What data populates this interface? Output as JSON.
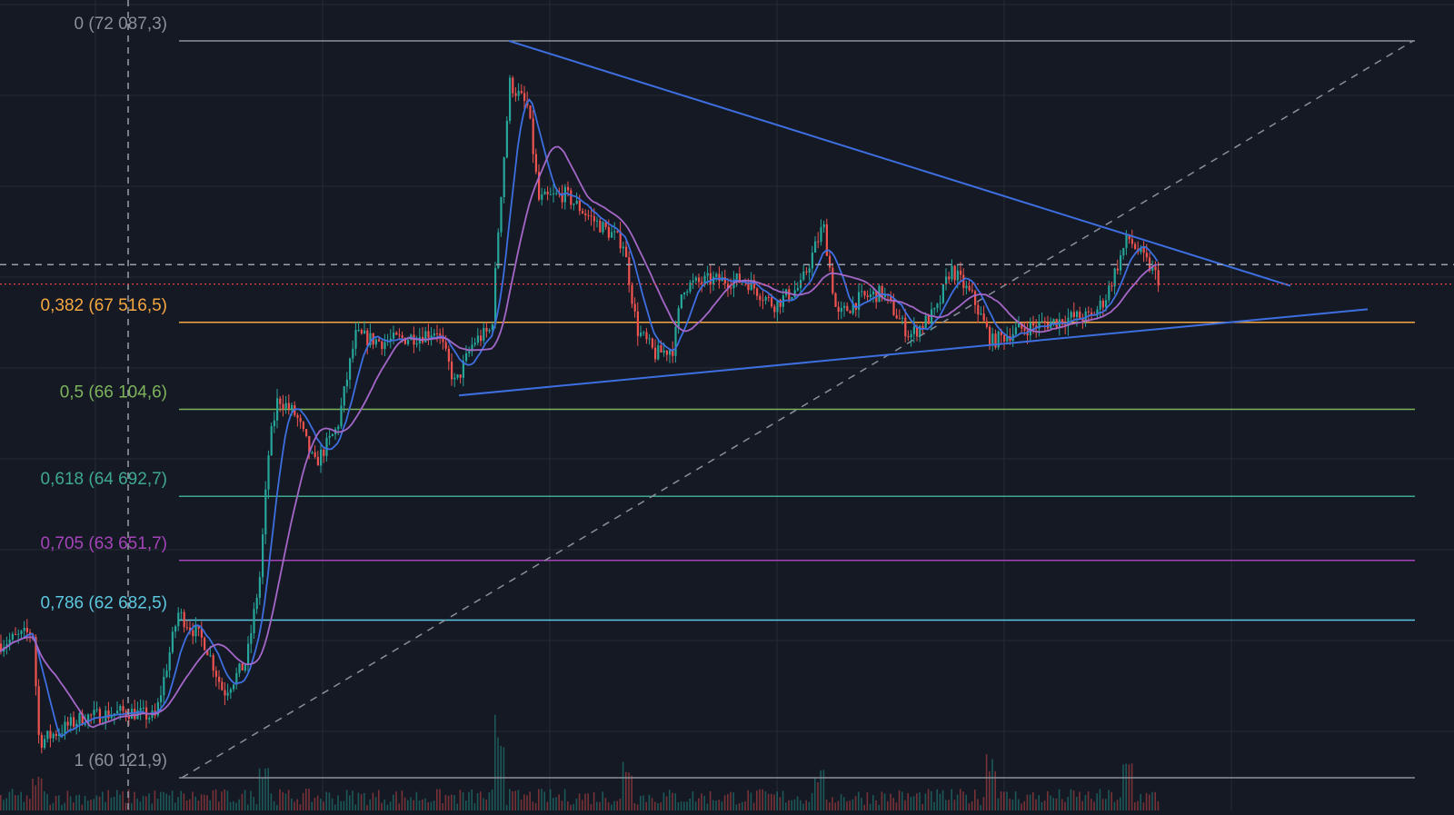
{
  "colors": {
    "background": "#151924",
    "grid": "#252a36",
    "candle_up": "#26a69a",
    "candle_down": "#ef5350",
    "ma_fast": "#3d6fe0",
    "ma_slow": "#a467c8",
    "trendline": "#3d6fe0",
    "diagonal": "#8a8f9a",
    "crosshair": "#9aa0aa",
    "price_line": "#e0454a"
  },
  "chart_data": {
    "type": "candlestick",
    "title": "",
    "price_range": [
      59900,
      72300
    ],
    "fib_levels": [
      {
        "label": "0 (72 087,3)",
        "ratio": 0,
        "price": 72087.3,
        "color": "#8b8f98"
      },
      {
        "label": "0,382 (67 516,5)",
        "ratio": 0.382,
        "price": 67516.5,
        "color": "#f5a742"
      },
      {
        "label": "0,5 (66 104,6)",
        "ratio": 0.5,
        "price": 66104.6,
        "color": "#7cb35b"
      },
      {
        "label": "0,618 (64 692,7)",
        "ratio": 0.618,
        "price": 64692.7,
        "color": "#3fa98e"
      },
      {
        "label": "0,705 (63 651,7)",
        "ratio": 0.705,
        "price": 63651.7,
        "color": "#a444b8"
      },
      {
        "label": "0,786 (62 682,5)",
        "ratio": 0.786,
        "price": 62682.5,
        "color": "#5cc8df"
      },
      {
        "label": "1 (60 121,9)",
        "ratio": 1,
        "price": 60121.9,
        "color": "#8b8f98"
      }
    ],
    "price_anchors": [
      [
        0,
        62300
      ],
      [
        35,
        62500
      ],
      [
        42,
        60700
      ],
      [
        90,
        61100
      ],
      [
        140,
        61200
      ],
      [
        170,
        61100
      ],
      [
        195,
        62800
      ],
      [
        225,
        62300
      ],
      [
        245,
        61500
      ],
      [
        270,
        62000
      ],
      [
        285,
        63400
      ],
      [
        295,
        65500
      ],
      [
        305,
        66300
      ],
      [
        325,
        66000
      ],
      [
        345,
        65200
      ],
      [
        370,
        65800
      ],
      [
        390,
        67300
      ],
      [
        420,
        67200
      ],
      [
        460,
        67300
      ],
      [
        480,
        67400
      ],
      [
        500,
        66500
      ],
      [
        520,
        67200
      ],
      [
        540,
        67400
      ],
      [
        548,
        69200
      ],
      [
        560,
        71400
      ],
      [
        580,
        71000
      ],
      [
        592,
        69500
      ],
      [
        620,
        69600
      ],
      [
        650,
        69200
      ],
      [
        685,
        68800
      ],
      [
        700,
        67400
      ],
      [
        720,
        67000
      ],
      [
        740,
        67100
      ],
      [
        750,
        68100
      ],
      [
        780,
        68200
      ],
      [
        820,
        68200
      ],
      [
        850,
        67800
      ],
      [
        880,
        68100
      ],
      [
        905,
        69100
      ],
      [
        920,
        67600
      ],
      [
        945,
        67900
      ],
      [
        970,
        68000
      ],
      [
        1000,
        67300
      ],
      [
        1030,
        67700
      ],
      [
        1045,
        68400
      ],
      [
        1070,
        67900
      ],
      [
        1090,
        67200
      ],
      [
        1120,
        67400
      ],
      [
        1180,
        67600
      ],
      [
        1200,
        67600
      ],
      [
        1215,
        67900
      ],
      [
        1240,
        68900
      ],
      [
        1265,
        68400
      ],
      [
        1275,
        68200
      ]
    ],
    "last_price": 68139,
    "crosshair_price": 68454,
    "trendlines": [
      {
        "name": "upper",
        "from": [
          560,
          72087
        ],
        "to": [
          1420,
          68110
        ]
      },
      {
        "name": "lower",
        "from": [
          505,
          66330
        ],
        "to": [
          1505,
          67730
        ]
      }
    ]
  }
}
